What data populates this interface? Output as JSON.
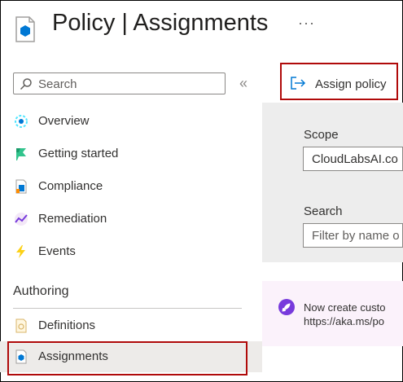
{
  "header": {
    "title": "Policy | Assignments",
    "more_label": "···",
    "icon": "policy-blade-icon"
  },
  "sidebar": {
    "search_placeholder": "Search",
    "collapse_label": "«",
    "items": [
      {
        "label": "Overview",
        "icon": "overview-icon"
      },
      {
        "label": "Getting started",
        "icon": "getting-started-icon"
      },
      {
        "label": "Compliance",
        "icon": "compliance-icon"
      },
      {
        "label": "Remediation",
        "icon": "remediation-icon"
      },
      {
        "label": "Events",
        "icon": "events-lightning-icon"
      }
    ],
    "section_authoring": "Authoring",
    "authoring_items": [
      {
        "label": "Definitions",
        "icon": "definitions-icon"
      },
      {
        "label": "Assignments",
        "icon": "assignments-icon",
        "selected": true
      }
    ]
  },
  "toolbar": {
    "assign_policy_label": "Assign policy"
  },
  "main": {
    "scope_label": "Scope",
    "scope_value": "CloudLabsAI.co",
    "search_label": "Search",
    "search_placeholder": "Filter by name o",
    "info_line1": "Now create custo",
    "info_line2": "https://aka.ms/po"
  },
  "colors": {
    "highlight": "#b00a0a",
    "accent": "#0078d4",
    "gray_panel": "#ededed",
    "info_panel": "#fbf2fb"
  }
}
